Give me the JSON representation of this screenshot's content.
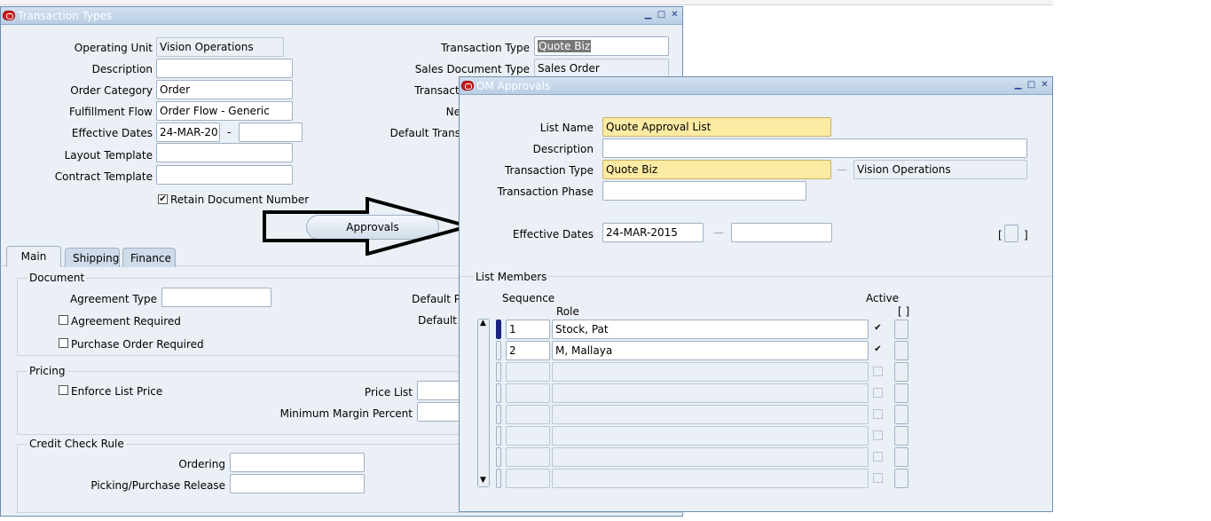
{
  "tt": {
    "title": "Transaction Types",
    "operating_unit_label": "Operating Unit",
    "operating_unit_value": "Vision Operations",
    "description_label": "Description",
    "order_category_label": "Order Category",
    "order_category_value": "Order",
    "fulfillment_flow_label": "Fulfillment Flow",
    "fulfillment_flow_value": "Order Flow - Generic",
    "effective_dates_label": "Effective Dates",
    "effective_from": "24-MAR-20",
    "date_dash": "-",
    "layout_template_label": "Layout Template",
    "contract_template_label": "Contract Template",
    "retain_doc_label": "Retain Document Number",
    "transaction_type_label": "Transaction Type",
    "transaction_type_value": "Quote Biz",
    "sales_doc_type_label": "Sales Document Type",
    "sales_doc_type_value": "Sales Order",
    "transacti_label": "Transacti",
    "ne_label": "Ne",
    "default_trans_label": "Default Trans",
    "approvals_button": "Approvals",
    "tabs": [
      "Main",
      "Shipping",
      "Finance"
    ],
    "document_group": "Document",
    "agreement_type_label": "Agreement Type",
    "agreement_required_label": "Agreement Required",
    "po_required_label": "Purchase Order Required",
    "default_p_label": "Default P",
    "default_label": "Default",
    "pricing_group": "Pricing",
    "enforce_list_price_label": "Enforce List Price",
    "price_list_label": "Price List",
    "min_margin_label": "Minimum Margin Percent",
    "credit_check_group": "Credit Check Rule",
    "ordering_label": "Ordering",
    "picking_label": "Picking/Purchase Release"
  },
  "om": {
    "title": "OM Approvals",
    "list_name_label": "List Name",
    "list_name_value": "Quote Approval List",
    "description_label": "Description",
    "transaction_type_label": "Transaction Type",
    "transaction_type_value": "Quote Biz",
    "operating_unit_value": "Vision Operations",
    "dash": "—",
    "transaction_phase_label": "Transaction Phase",
    "effective_dates_label": "Effective Dates",
    "effective_from": "24-MAR-2015",
    "bracket_open": "[",
    "bracket_close": "]",
    "list_members_label": "List Members",
    "sequence_header": "Sequence",
    "role_header": "Role",
    "active_header": "Active",
    "brackets_header": "[ ]",
    "members": [
      {
        "seq": "1",
        "role": "Stock, Pat",
        "active": "✔"
      },
      {
        "seq": "2",
        "role": "M, Mallaya",
        "active": "✔"
      },
      {
        "seq": "",
        "role": "",
        "active": ""
      },
      {
        "seq": "",
        "role": "",
        "active": ""
      },
      {
        "seq": "",
        "role": "",
        "active": ""
      },
      {
        "seq": "",
        "role": "",
        "active": ""
      },
      {
        "seq": "",
        "role": "",
        "active": ""
      },
      {
        "seq": "",
        "role": "",
        "active": ""
      }
    ]
  },
  "window_buttons": {
    "minimize": "▁",
    "maximize": "□",
    "close": "✕"
  },
  "colors": {
    "title_text": "#ffffff",
    "required_field": "#fdeba3",
    "window_bg": "#ebf0f6"
  }
}
